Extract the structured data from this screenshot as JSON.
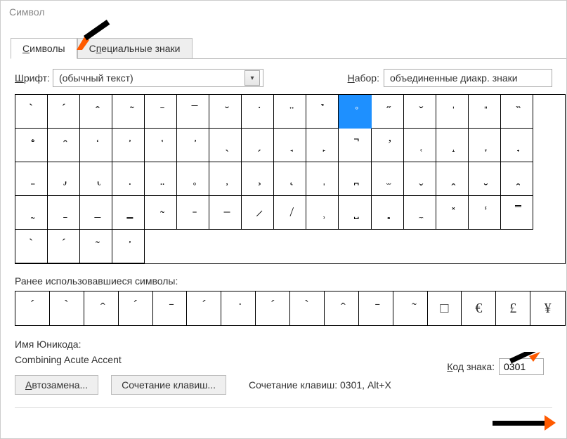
{
  "title": "Символ",
  "tabs": {
    "symbols": {
      "prefix": "С",
      "rest": "имволы"
    },
    "special": {
      "prefix": "С",
      "mid": "п",
      "rest": "ециальные знаки"
    }
  },
  "font_row": {
    "label_prefix": "Ш",
    "label_rest": "рифт:",
    "value": "(обычный текст)"
  },
  "set_row": {
    "label_prefix": "Н",
    "label_rest": "абор:",
    "value": "объединенные диакр. знаки"
  },
  "grid_symbols": [
    "̀",
    "́",
    "̂",
    "̃",
    "̄",
    "̅",
    "̆",
    "̇",
    "̈",
    "̉",
    "̊",
    "̋",
    "̌",
    "̍",
    "̎",
    "̏",
    "̐",
    "̑",
    "̒",
    "̓",
    "̔",
    "̕",
    "̖",
    "̗",
    "̘",
    "̙",
    "̚",
    "̛",
    "̜",
    "̝",
    "̞",
    "̟",
    "̠",
    "̡",
    "̢",
    "̣",
    "̤",
    "̥",
    "̦",
    "̧",
    "̨",
    "̩",
    "̪",
    "̫",
    "̬",
    "̭",
    "̮",
    "̯",
    "̰",
    "̱",
    "̲",
    "̳",
    "̴",
    "̵",
    "̶",
    "̷",
    "̸",
    "̹",
    "̺",
    "̻",
    "̼",
    "̽",
    "̾",
    "̿",
    "̀",
    "́",
    "͂",
    "̓"
  ],
  "selected_index": 10,
  "recent_label": "Ранее использовавшиеся символы:",
  "recent_symbols": [
    "́",
    "̀",
    "̂",
    "́",
    "̄",
    "́",
    "̇",
    "́",
    "̀",
    "̂",
    "̄",
    "̃",
    "□",
    "€",
    "£",
    "¥"
  ],
  "unicode_name_label": "Имя Юникода:",
  "unicode_name_value": "Combining Acute Accent",
  "code_label_prefix": "К",
  "code_label_rest": "од знака:",
  "code_value": "0301",
  "autocorrect_btn": {
    "prefix": "А",
    "rest": "втозамена..."
  },
  "shortcut_btn": "Сочетание клавиш...",
  "shortcut_info": "Сочетание клавиш: 0301, Alt+X"
}
